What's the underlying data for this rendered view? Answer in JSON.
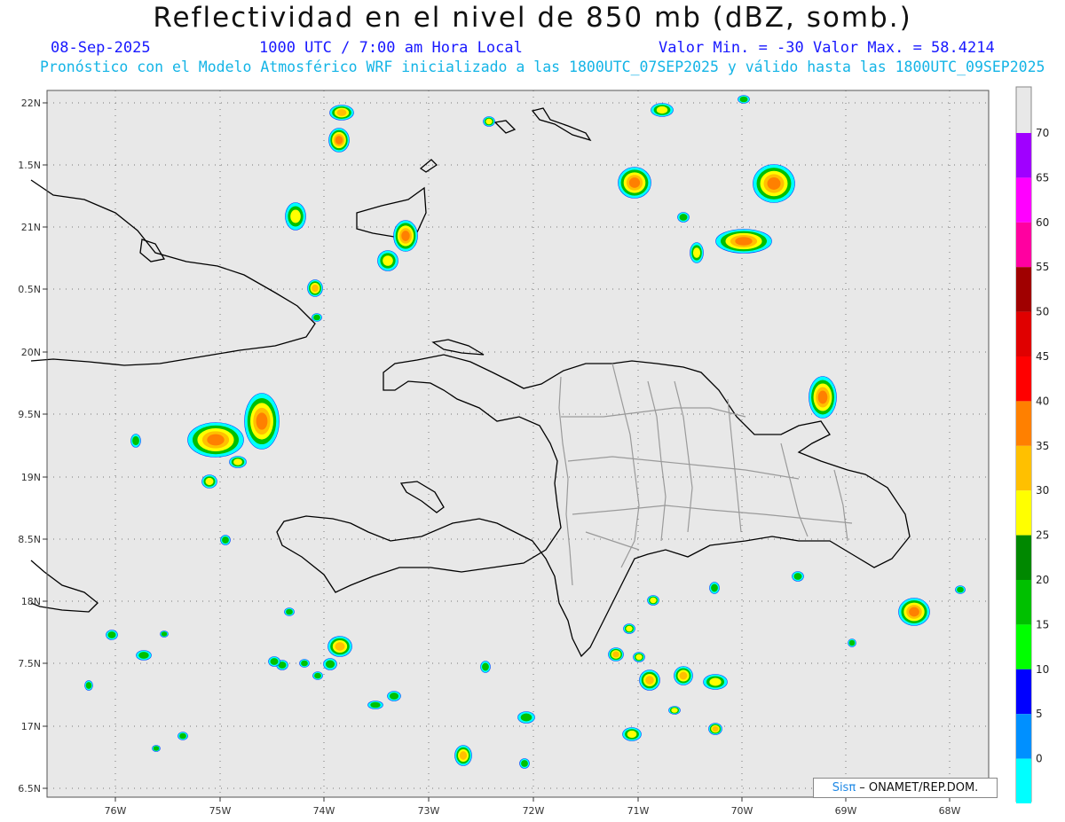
{
  "title": "Reflectividad en el nivel de 850 mb (dBZ, somb.)",
  "header": {
    "date": "08-Sep-2025",
    "time": "1000 UTC / 7:00 am Hora Local",
    "minmax": "Valor Min. = -30  Valor Max. = 58.4214",
    "subtitle": "Pronóstico con el Modelo Atmosférico WRF inicializado a las 1800UTC_07SEP2025 y válido hasta las  1800UTC_09SEP2025"
  },
  "map": {
    "lon_labels": [
      "76W",
      "75W",
      "74W",
      "73W",
      "72W",
      "71W",
      "70W",
      "69W",
      "68W"
    ],
    "lat_labels": [
      "22N",
      "1.5N",
      "21N",
      "0.5N",
      "20N",
      "9.5N",
      "19N",
      "8.5N",
      "18N",
      "7.5N",
      "17N",
      "6.5N"
    ],
    "lon_range": [
      -76.6,
      -67.5
    ],
    "lat_range": [
      16.45,
      22.1
    ],
    "grid": true
  },
  "colorbar": {
    "labels": [
      "70",
      "65",
      "60",
      "55",
      "50",
      "45",
      "40",
      "35",
      "30",
      "25",
      "20",
      "15",
      "10",
      "5",
      "0"
    ],
    "colors": [
      "#a000ff",
      "#ff00ff",
      "#ff00a0",
      "#a00000",
      "#e00000",
      "#ff0000",
      "#ff8000",
      "#ffc000",
      "#ffff00",
      "#008800",
      "#00c000",
      "#00ff00",
      "#0000ff",
      "#0090ff",
      "#00ffff"
    ]
  },
  "credit": {
    "logo": "Sis",
    "logo_pi": "π",
    "text": " – ONAMET/REP.DOM."
  }
}
